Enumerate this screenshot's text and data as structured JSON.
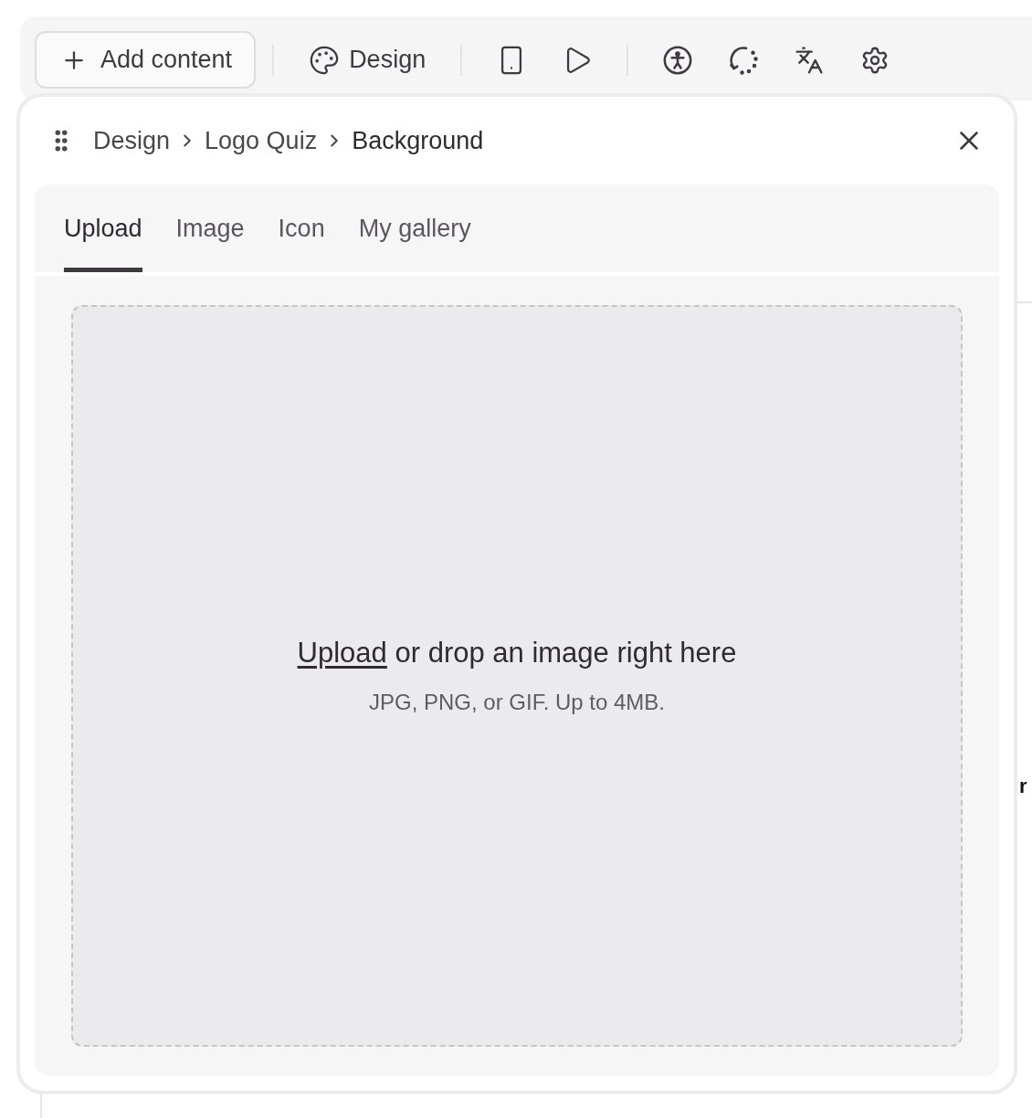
{
  "toolbar": {
    "add_button": {
      "label": "Add content"
    },
    "design_button": {
      "label": "Design"
    }
  },
  "panel": {
    "breadcrumb": [
      "Design",
      "Logo Quiz",
      "Background"
    ],
    "tabs": [
      {
        "label": "Upload",
        "selected": true
      },
      {
        "label": "Image",
        "selected": false
      },
      {
        "label": "Icon",
        "selected": false
      },
      {
        "label": "My gallery",
        "selected": false
      }
    ],
    "dropzone": {
      "link": "Upload",
      "text": "or drop an image right here",
      "hint": "JPG, PNG, or GIF. Up to 4MB."
    }
  },
  "background_text": "r"
}
